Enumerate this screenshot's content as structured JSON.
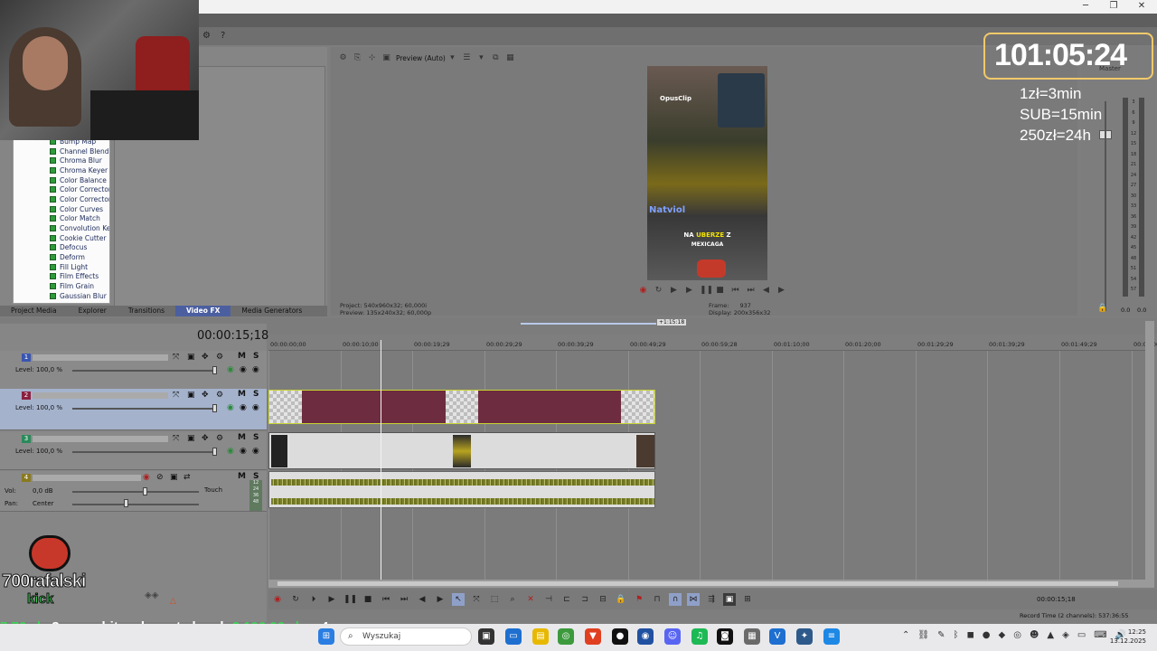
{
  "window": {
    "minimize": "─",
    "maximize": "❐",
    "close": "✕"
  },
  "effects_list": {
    "items": [
      "Bump Map",
      "Channel Blend",
      "Chroma Blur",
      "Chroma Keyer",
      "Color Balance",
      "Color Corrector",
      "Color Corrector (S",
      "Color Curves",
      "Color Match",
      "Convolution Kerne",
      "Cookie Cutter",
      "Defocus",
      "Deform",
      "Fill Light",
      "Film Effects",
      "Film Grain",
      "Gaussian Blur"
    ]
  },
  "panel_tabs": [
    {
      "label": "Project Media",
      "active": false
    },
    {
      "label": "Explorer",
      "active": false
    },
    {
      "label": "Transitions",
      "active": false
    },
    {
      "label": "Video FX",
      "active": true
    },
    {
      "label": "Media Generators",
      "active": false
    }
  ],
  "preview": {
    "mode_label": "Preview (Auto)",
    "video_overlay": {
      "brand": "OpusClip",
      "caption_name": "Natviol",
      "caption_line1_pre": "NA ",
      "caption_highlight": "UBERZE",
      "caption_line1_post": " Z",
      "caption_line2": "MEXICAGA"
    },
    "project_label": "Project:",
    "project_value": "540x960x32; 60,000i",
    "preview_label": "Preview:",
    "preview_value": "135x240x32; 60,000p",
    "frame_label": "Frame:",
    "frame_value": "937",
    "display_label": "Display:",
    "display_value": "200x356x32"
  },
  "master": {
    "label": "Master",
    "scale": [
      "3",
      "6",
      "9",
      "12",
      "15",
      "18",
      "21",
      "24",
      "27",
      "30",
      "33",
      "36",
      "39",
      "42",
      "45",
      "48",
      "51",
      "54",
      "57"
    ],
    "level_left": "0.0",
    "level_right": "0.0"
  },
  "stream_overlay": {
    "timer": "101:05:24",
    "rate1": "1zł=3min",
    "rate2": "SUB=15min",
    "rate3": "250zł=24h",
    "channel_name": "700rafalski",
    "channel_platform": "kick",
    "ticker_money1": "7,76 zł",
    "ticker_site": "3. www.hitoszkomat.cba.pl:",
    "ticker_money2": "2 106,06 zł",
    "ticker_num": "4."
  },
  "timeline": {
    "current_time": "00:00:15;18",
    "ruler_badge": "+1:15:18",
    "ruler_ticks": [
      "00:00:00;00",
      "00:00:10;00",
      "00:00:19;29",
      "00:00:29;29",
      "00:00:39;29",
      "00:00:49;29",
      "00:00:59;28",
      "00:01:10;00",
      "00:01:20;00",
      "00:01:29;29",
      "00:01:39;29",
      "00:01:49;29",
      "00:02:00"
    ],
    "tracks": [
      {
        "num": "1",
        "type": "video",
        "level": "Level: 100,0 %",
        "selected": false
      },
      {
        "num": "2",
        "type": "video",
        "level": "Level: 100,0 %",
        "selected": true
      },
      {
        "num": "3",
        "type": "video",
        "level": "Level: 100,0 %",
        "selected": false
      }
    ],
    "audio_track": {
      "num": "4",
      "vol_label": "Vol:",
      "vol_value": "0,0 dB",
      "pan_label": "Pan:",
      "pan_value": "Center",
      "automation": "Touch",
      "meter_scale": [
        "12",
        "24",
        "36",
        "48"
      ]
    },
    "mute": "M",
    "solo": "S",
    "bottom_time": "00:00:15;18",
    "record_time": "Record Time (2 channels): 537:36:55"
  },
  "taskbar": {
    "search_placeholder": "Wyszukaj",
    "time": "12:25",
    "date": "13.12.2025"
  },
  "colors": {
    "track2_clip": "#6d2c3f",
    "selected_track": "#a4b2cc",
    "overlay_green": "#39d353"
  }
}
